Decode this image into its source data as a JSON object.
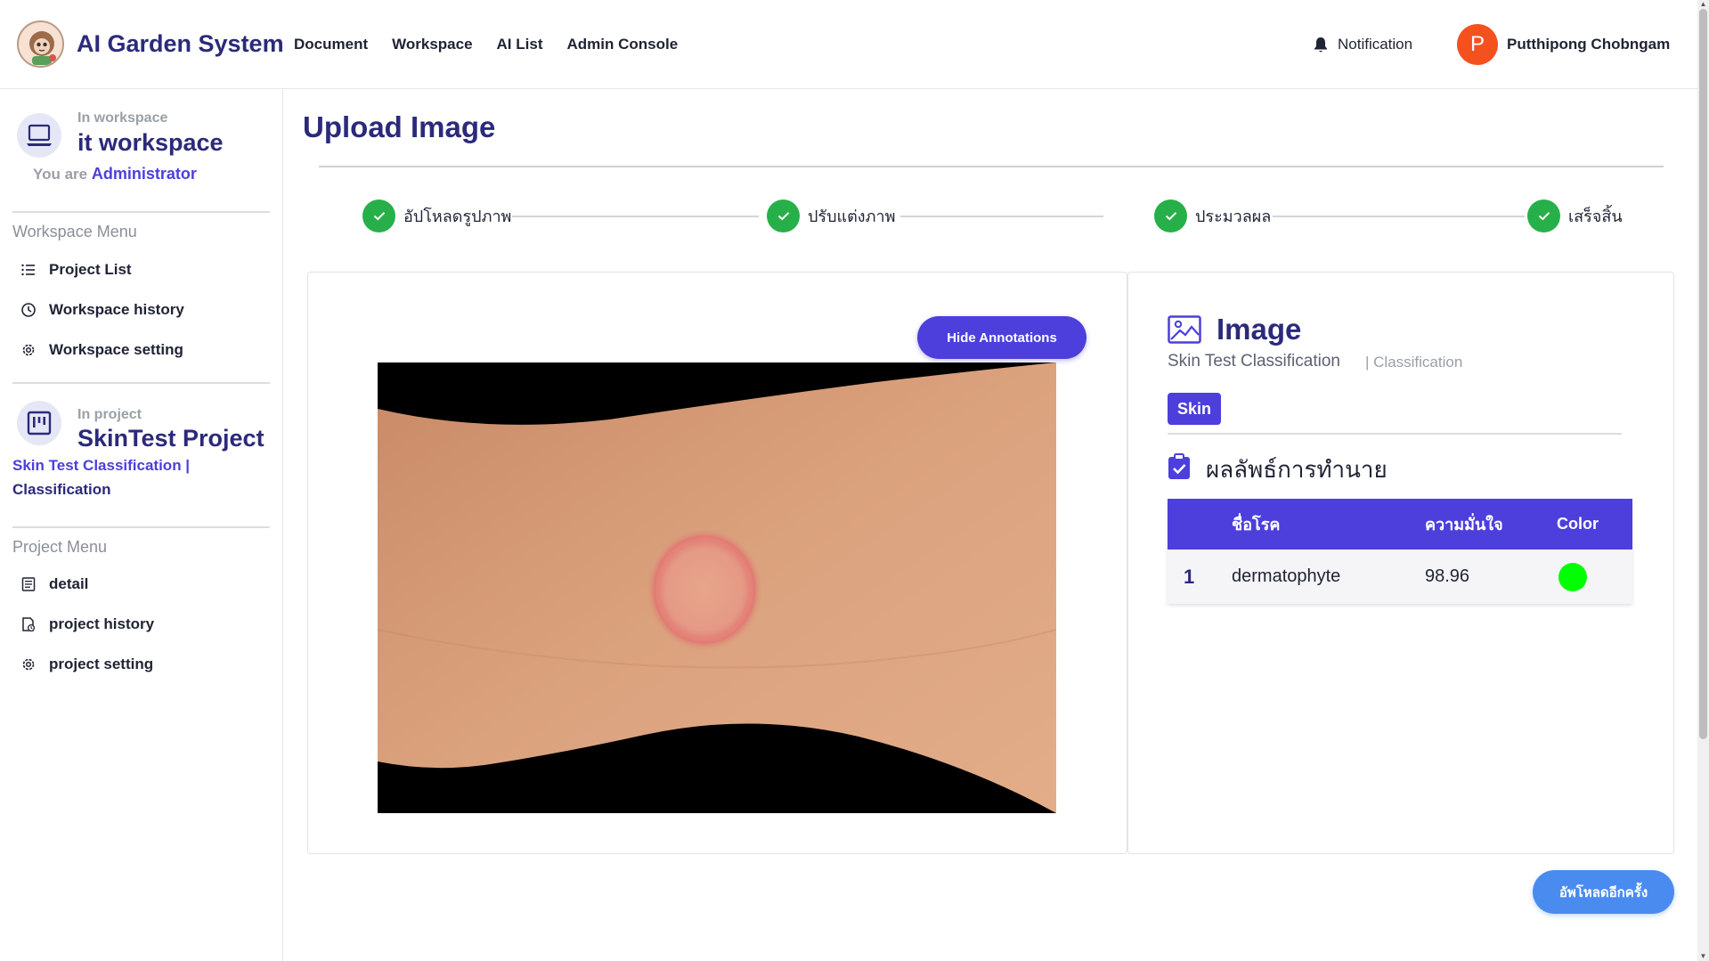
{
  "header": {
    "app_title": "AI Garden System",
    "nav": [
      "Document",
      "Workspace",
      "AI List",
      "Admin Console"
    ],
    "notification_label": "Notification",
    "avatar_letter": "P",
    "user_name": "Putthipong Chobngam"
  },
  "sidebar": {
    "workspace_caption": "In workspace",
    "workspace_name": "it workspace",
    "role_prefix": "You are",
    "role": "Administrator",
    "workspace_menu_title": "Workspace Menu",
    "workspace_menu": [
      "Project List",
      "Workspace history",
      "Workspace setting"
    ],
    "project_caption": "In project",
    "project_name": "SkinTest Project",
    "project_meta_line1": "Skin Test Classification |",
    "project_meta_line2": "Classification",
    "project_menu_title": "Project Menu",
    "project_menu": [
      "detail",
      "project history",
      "project setting"
    ]
  },
  "main": {
    "page_title": "Upload Image",
    "steps": [
      "อัปโหลดรูปภาพ",
      "ปรับแต่งภาพ",
      "ประมวลผล",
      "เสร็จสิ้น"
    ],
    "hide_annotations_label": "Hide Annotations",
    "reupload_label": "อัพโหลดอีกครั้ง"
  },
  "image_panel": {
    "title": "Image",
    "subtitle": "Skin Test Classification",
    "type": "| Classification",
    "tag": "Skin",
    "result_title": "ผลลัพธ์การทำนาย",
    "table_headers": [
      "ชื่อโรค",
      "ความมั่นใจ",
      "Color"
    ],
    "rows": [
      {
        "rank": "1",
        "disease": "dermatophyte",
        "confidence": "98.96",
        "color": "#00ff00"
      }
    ]
  },
  "colors": {
    "brand_navy": "#2b2a7a",
    "primary": "#4c3fdc",
    "success": "#27b049",
    "secondary_button": "#4a8bf0",
    "avatar": "#f4511e"
  }
}
